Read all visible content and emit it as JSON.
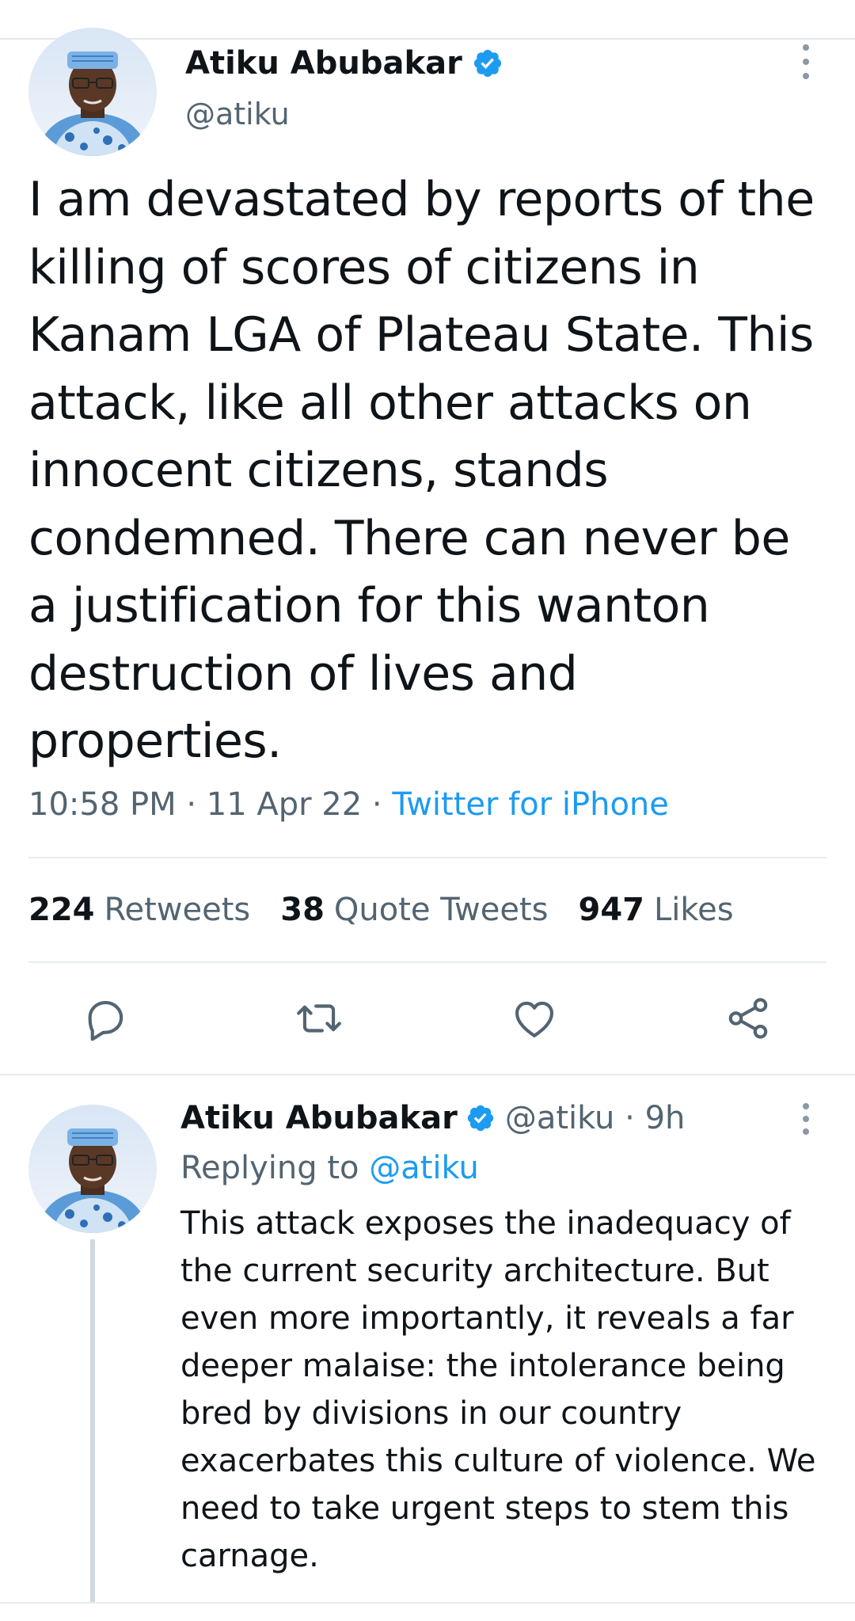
{
  "main_tweet": {
    "author_name": "Atiku Abubakar",
    "handle": "@atiku",
    "text": "I am devastated by reports of the killing of scores of citizens in Kanam LGA of Plateau State. This attack, like all other attacks on innocent citizens, stands condemned. There can never be a justification for this wanton destruction of lives and properties.",
    "time": "10:58 PM",
    "separator": " · ",
    "date": "11 Apr 22",
    "source": "Twitter for iPhone",
    "stats": {
      "retweets_count": "224",
      "retweets_label": "Retweets",
      "quotes_count": "38",
      "quotes_label": "Quote Tweets",
      "likes_count": "947",
      "likes_label": "Likes"
    },
    "actions": [
      "reply-icon",
      "retweet-icon",
      "like-icon",
      "share-icon"
    ]
  },
  "reply_tweet": {
    "author_name": "Atiku Abubakar",
    "handle": "@atiku",
    "separator": " · ",
    "age": "9h",
    "replying_prefix": "Replying to ",
    "replying_to": "@atiku",
    "text": "This attack exposes the inadequacy of the current security architecture. But even more importantly, it reveals a far deeper malaise: the intolerance being bred by divisions in our country exacerbates this culture of violence. We need to take urgent steps to stem this carnage."
  },
  "colors": {
    "accent": "#1d9bf0",
    "text_primary": "#0f1419",
    "text_secondary": "#536471",
    "divider": "#e6ecf0"
  }
}
